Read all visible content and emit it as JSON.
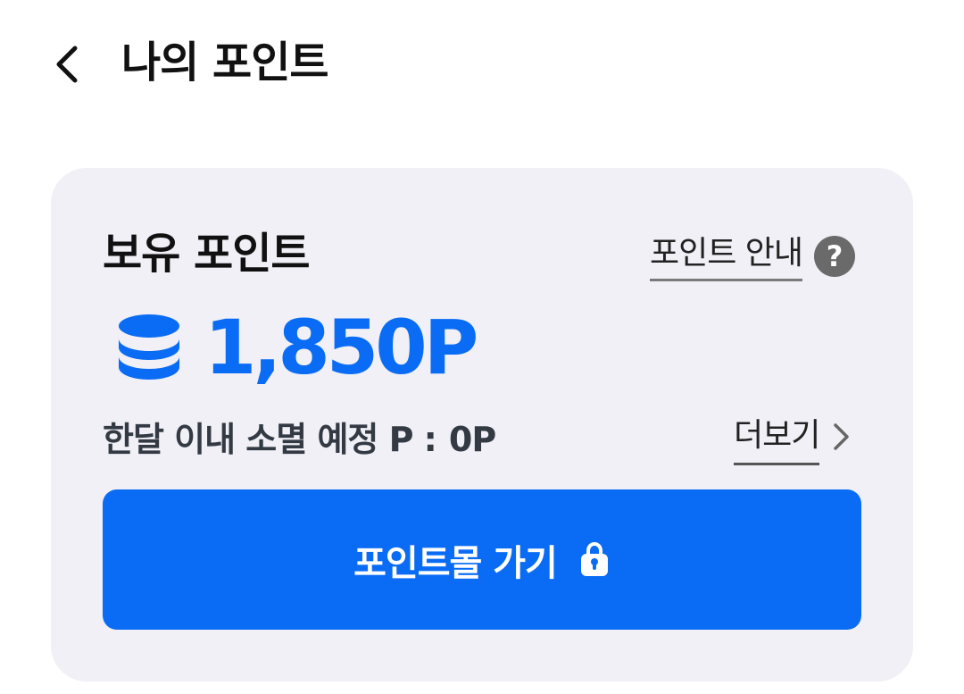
{
  "header": {
    "title": "나의 포인트",
    "back_icon": "chevron-left-icon"
  },
  "card": {
    "section_title": "보유 포인트",
    "guide_label": "포인트 안내",
    "help_icon_glyph": "?",
    "points_value": "1,850P",
    "coin_icon": "coin-stack-icon",
    "expire_label": "한달 이내 소멸 예정 P :",
    "expire_value": "0P",
    "more_label": "더보기",
    "mall_button_label": "포인트몰 가기",
    "mall_icon": "shopping-bag-icon"
  },
  "colors": {
    "accent": "#0a6cf5",
    "card_bg": "#f0f0f6",
    "text_primary": "#111111",
    "text_secondary": "#333a44",
    "help_icon_bg": "#6a6a6a"
  }
}
